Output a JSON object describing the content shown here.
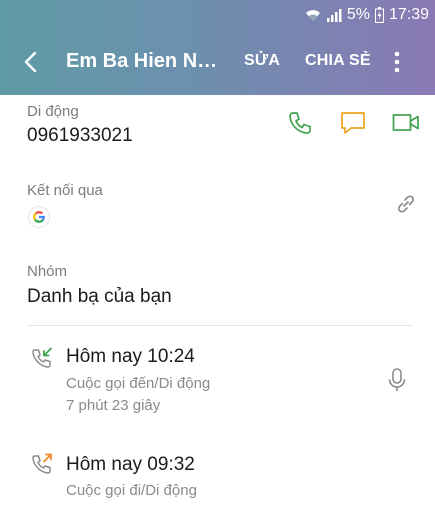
{
  "status": {
    "battery": "5%",
    "time": "17:39"
  },
  "appbar": {
    "title": "Em Ba Hien Nha…",
    "edit": "SỬA",
    "share": "CHIA SẺ"
  },
  "contact": {
    "phone_label": "Di động",
    "phone_number": "0961933021",
    "linked_label": "Kết nối qua",
    "group_label": "Nhóm",
    "group_value": "Danh bạ của bạn"
  },
  "call_log": [
    {
      "title": "Hôm nay 10:24",
      "type": "Cuộc gọi đến/Di động",
      "duration": "7 phút 23 giây"
    },
    {
      "title": "Hôm nay 09:32",
      "type": "Cuộc gọi đi/Di động"
    }
  ],
  "colors": {
    "call_icon": "#3fa34d",
    "message_icon": "#e8a41c",
    "video_icon": "#3fa34d",
    "incoming_arrow": "#3fa34d",
    "outgoing_arrow": "#f08a24"
  },
  "icons": [
    "wifi-icon",
    "signal-icon",
    "battery-icon",
    "back-icon",
    "more-icon",
    "call-icon",
    "message-icon",
    "video-call-icon",
    "google-icon",
    "link-icon",
    "incoming-call-icon",
    "voice-recording-icon",
    "outgoing-call-icon"
  ]
}
